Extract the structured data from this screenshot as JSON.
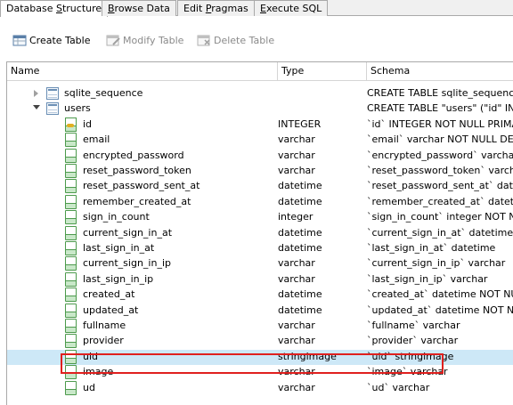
{
  "tabs": [
    {
      "pre": "Database ",
      "u": "S",
      "post": "tructure",
      "active": true
    },
    {
      "pre": "",
      "u": "B",
      "post": "rowse Data",
      "active": false
    },
    {
      "pre": "Edit ",
      "u": "P",
      "post": "ragmas",
      "active": false
    },
    {
      "pre": "",
      "u": "E",
      "post": "xecute SQL",
      "active": false
    }
  ],
  "toolbar": {
    "create_table": "Create Table",
    "modify_table": "Modify Table",
    "delete_table": "Delete Table"
  },
  "columns": {
    "name": "Name",
    "type": "Type",
    "schema": "Schema"
  },
  "tables": [
    {
      "name": "sqlite_sequence",
      "type": "",
      "schema": "CREATE TABLE sqlite_sequence(",
      "expanded": false
    },
    {
      "name": "users",
      "type": "",
      "schema": "CREATE TABLE \"users\" (\"id\" INTE",
      "expanded": true
    }
  ],
  "fields": [
    {
      "name": "id",
      "type": "INTEGER",
      "schema": "`id` INTEGER NOT NULL PRIMA",
      "key": true
    },
    {
      "name": "email",
      "type": "varchar",
      "schema": "`email` varchar NOT NULL DEF"
    },
    {
      "name": "encrypted_password",
      "type": "varchar",
      "schema": "`encrypted_password` varchar N"
    },
    {
      "name": "reset_password_token",
      "type": "varchar",
      "schema": "`reset_password_token` varcha"
    },
    {
      "name": "reset_password_sent_at",
      "type": "datetime",
      "schema": "`reset_password_sent_at` date"
    },
    {
      "name": "remember_created_at",
      "type": "datetime",
      "schema": "`remember_created_at` datetim"
    },
    {
      "name": "sign_in_count",
      "type": "integer",
      "schema": "`sign_in_count` integer NOT N"
    },
    {
      "name": "current_sign_in_at",
      "type": "datetime",
      "schema": "`current_sign_in_at` datetime"
    },
    {
      "name": "last_sign_in_at",
      "type": "datetime",
      "schema": "`last_sign_in_at` datetime"
    },
    {
      "name": "current_sign_in_ip",
      "type": "varchar",
      "schema": "`current_sign_in_ip` varchar"
    },
    {
      "name": "last_sign_in_ip",
      "type": "varchar",
      "schema": "`last_sign_in_ip` varchar"
    },
    {
      "name": "created_at",
      "type": "datetime",
      "schema": "`created_at` datetime NOT NUL"
    },
    {
      "name": "updated_at",
      "type": "datetime",
      "schema": "`updated_at` datetime NOT NU"
    },
    {
      "name": "fullname",
      "type": "varchar",
      "schema": "`fullname` varchar"
    },
    {
      "name": "provider",
      "type": "varchar",
      "schema": "`provider` varchar"
    },
    {
      "name": "uid",
      "type": "stringimage",
      "schema": "`uid` stringimage",
      "selected": true
    },
    {
      "name": "image",
      "type": "varchar",
      "schema": "`image` varchar"
    },
    {
      "name": "ud",
      "type": "varchar",
      "schema": "`ud` varchar"
    }
  ],
  "colors": {
    "selection": "#cde8f7",
    "highlight_box": "#e0201e",
    "field_icon": "#4c9a4c"
  }
}
